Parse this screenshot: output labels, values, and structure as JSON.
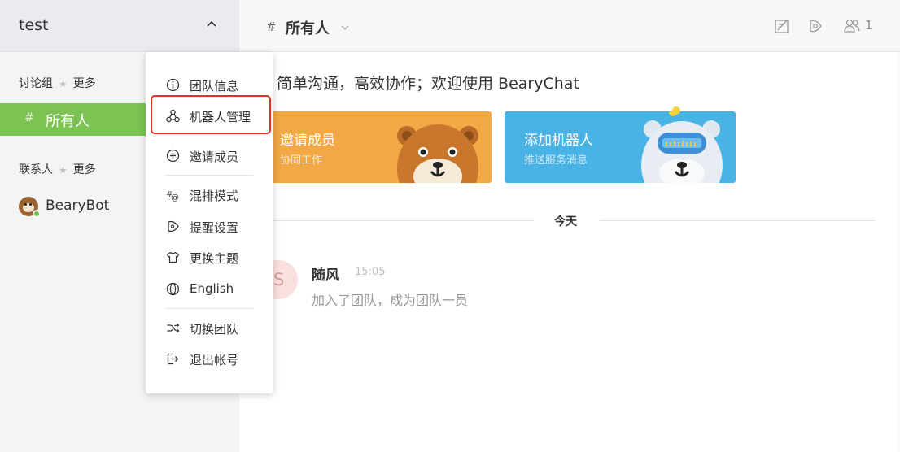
{
  "sidebar": {
    "team_name": "test",
    "groups_section": {
      "title": "讨论组",
      "star": "★",
      "more": "更多"
    },
    "active_channel": {
      "hash": "#",
      "name": "所有人"
    },
    "contacts_section": {
      "title": "联系人",
      "star": "★",
      "more": "更多"
    },
    "contacts": [
      {
        "name": "BearyBot",
        "status": "online"
      }
    ]
  },
  "header": {
    "hash": "#",
    "title": "所有人",
    "member_count": "1",
    "icons": [
      "edit-icon",
      "reminder-icon",
      "members-icon"
    ]
  },
  "main": {
    "welcome": "简单沟通，高效协作；欢迎使用 BearyChat",
    "cards": [
      {
        "title": "邀请成员",
        "subtitle": "协同工作",
        "color": "#f2a845"
      },
      {
        "title": "添加机器人",
        "subtitle": "推送服务消息",
        "color": "#49b3e5"
      }
    ],
    "date_divider": "今天",
    "message": {
      "avatar_letter": "S",
      "sender": "随风",
      "time": "15:05",
      "text": "加入了团队，成为团队一员"
    }
  },
  "menu": {
    "items": [
      {
        "label": "团队信息",
        "icon": "info-icon"
      },
      {
        "label": "机器人管理",
        "icon": "robot-icon",
        "highlighted": true
      },
      {
        "label": "邀请成员",
        "icon": "add-circle-icon"
      },
      {
        "label": "混排模式",
        "icon": "hash-at-icon"
      },
      {
        "label": "提醒设置",
        "icon": "reminder-icon"
      },
      {
        "label": "更换主题",
        "icon": "shirt-icon"
      },
      {
        "label": "English",
        "icon": "globe-icon"
      },
      {
        "label": "切换团队",
        "icon": "shuffle-icon"
      },
      {
        "label": "退出帐号",
        "icon": "logout-icon"
      }
    ],
    "highlight_color": "#e0322b"
  },
  "colors": {
    "accent_green": "#7dc353",
    "online": "#6ec241"
  }
}
